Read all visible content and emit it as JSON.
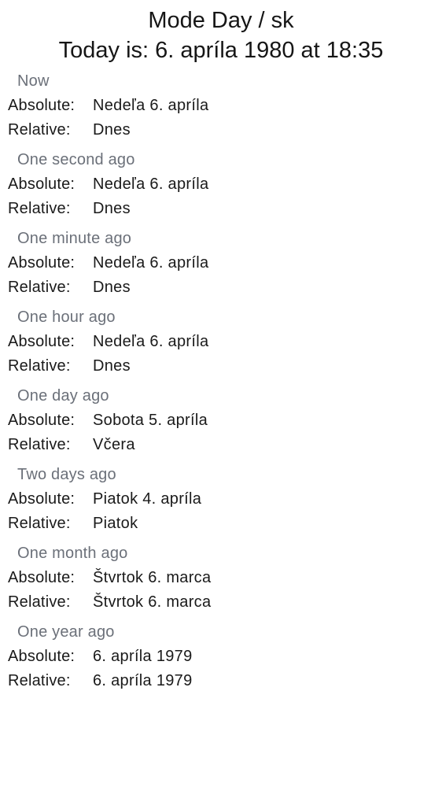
{
  "header": {
    "title": "Mode Day / sk",
    "subtitle": "Today is: 6. apríla 1980 at 18:35"
  },
  "labels": {
    "absolute": "Absolute:",
    "relative": "Relative:"
  },
  "sections": [
    {
      "title": "Now",
      "absolute": "Nedeľa 6. apríla",
      "relative": "Dnes"
    },
    {
      "title": "One second ago",
      "absolute": "Nedeľa 6. apríla",
      "relative": "Dnes"
    },
    {
      "title": "One minute ago",
      "absolute": "Nedeľa 6. apríla",
      "relative": "Dnes"
    },
    {
      "title": "One hour ago",
      "absolute": "Nedeľa 6. apríla",
      "relative": "Dnes"
    },
    {
      "title": "One day ago",
      "absolute": "Sobota 5. apríla",
      "relative": "Včera"
    },
    {
      "title": "Two days ago",
      "absolute": "Piatok 4. apríla",
      "relative": "Piatok"
    },
    {
      "title": "One month ago",
      "absolute": "Štvrtok 6. marca",
      "relative": "Štvrtok 6. marca"
    },
    {
      "title": "One year ago",
      "absolute": "6. apríla 1979",
      "relative": "6. apríla 1979"
    }
  ]
}
